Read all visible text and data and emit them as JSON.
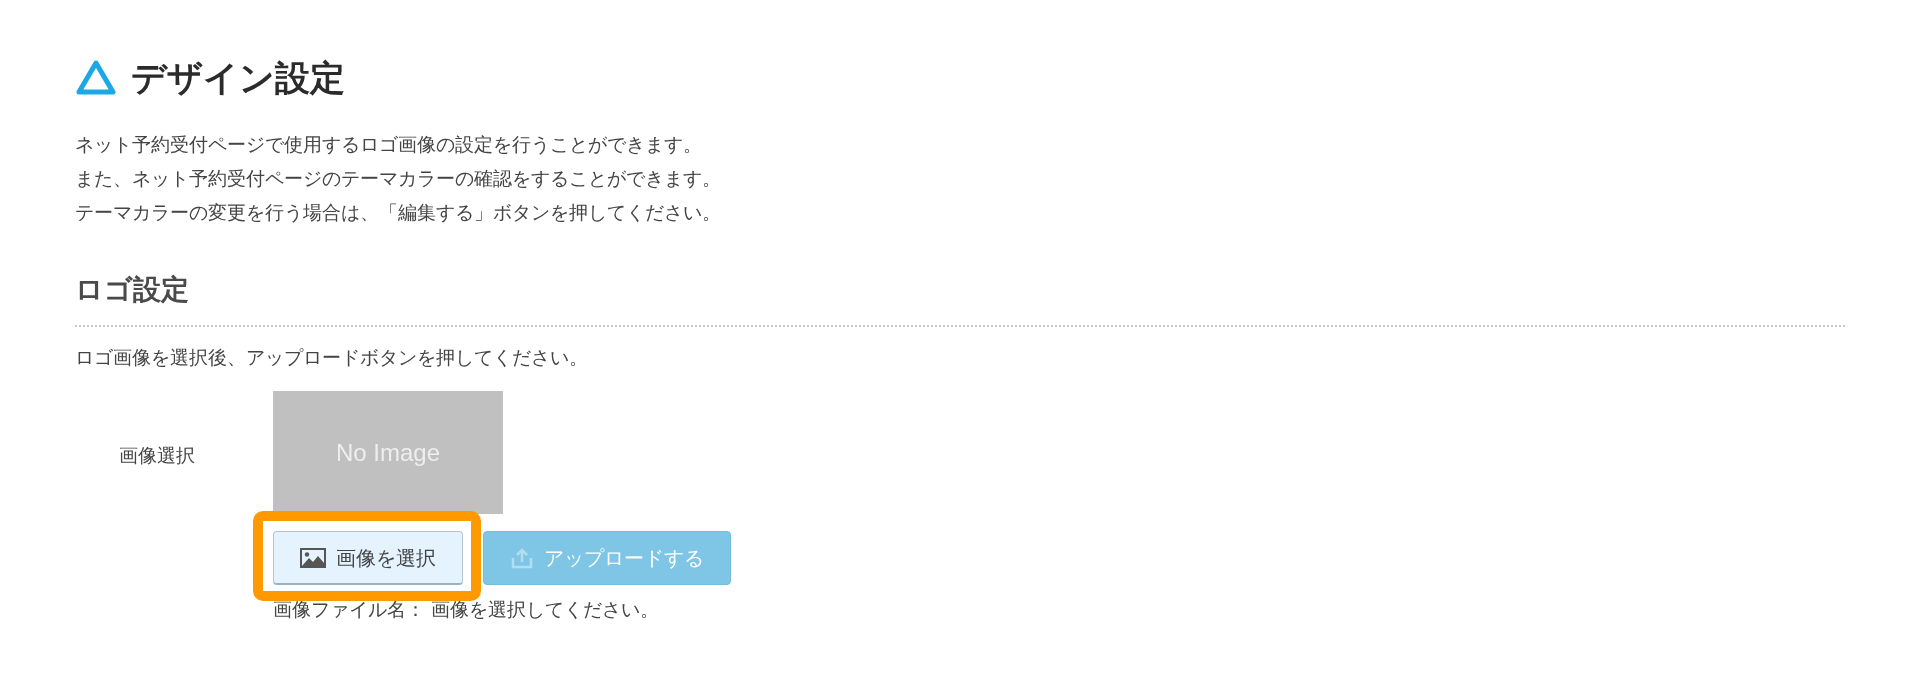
{
  "page_title": "デザイン設定",
  "description": [
    "ネット予約受付ページで使用するロゴ画像の設定を行うことができます。",
    "また、ネット予約受付ページのテーマカラーの確認をすることができます。",
    "テーマカラーの変更を行う場合は、「編集する」ボタンを押してください。"
  ],
  "logo_section": {
    "heading": "ロゴ設定",
    "instruction": "ロゴ画像を選択後、アップロードボタンを押してください。",
    "field_label": "画像選択",
    "preview_text": "No Image",
    "buttons": [
      {
        "kind": "select",
        "label": "画像を選択",
        "disabled": false,
        "highlighted": true
      },
      {
        "kind": "upload",
        "label": "アップロードする",
        "disabled": true,
        "highlighted": false
      }
    ],
    "file_name_label": "画像ファイル名：",
    "file_name_value": "画像を選択してください。"
  }
}
